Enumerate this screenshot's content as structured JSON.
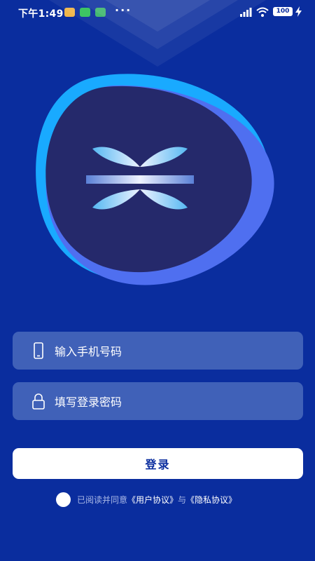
{
  "status_bar": {
    "time": "下午1:49",
    "more": "···",
    "battery": "100"
  },
  "form": {
    "phone_placeholder": "输入手机号码",
    "password_placeholder": "填写登录密码",
    "login_label": "登录"
  },
  "agreement": {
    "prefix": "已阅读并同意",
    "user_agreement": "《用户协议》",
    "conjunction": "与",
    "privacy_policy": "《隐私协议》"
  },
  "colors": {
    "background": "#0a2d9e",
    "field": "#5f7fd0",
    "button": "#ffffff",
    "button_text": "#0a2d9e",
    "logo_dark": "#25296b",
    "logo_accent": "#4f6ff0"
  },
  "icons": [
    "phone-icon",
    "lock-icon",
    "signal-icon",
    "wifi-icon",
    "battery-icon",
    "charging-icon",
    "app-logo"
  ]
}
